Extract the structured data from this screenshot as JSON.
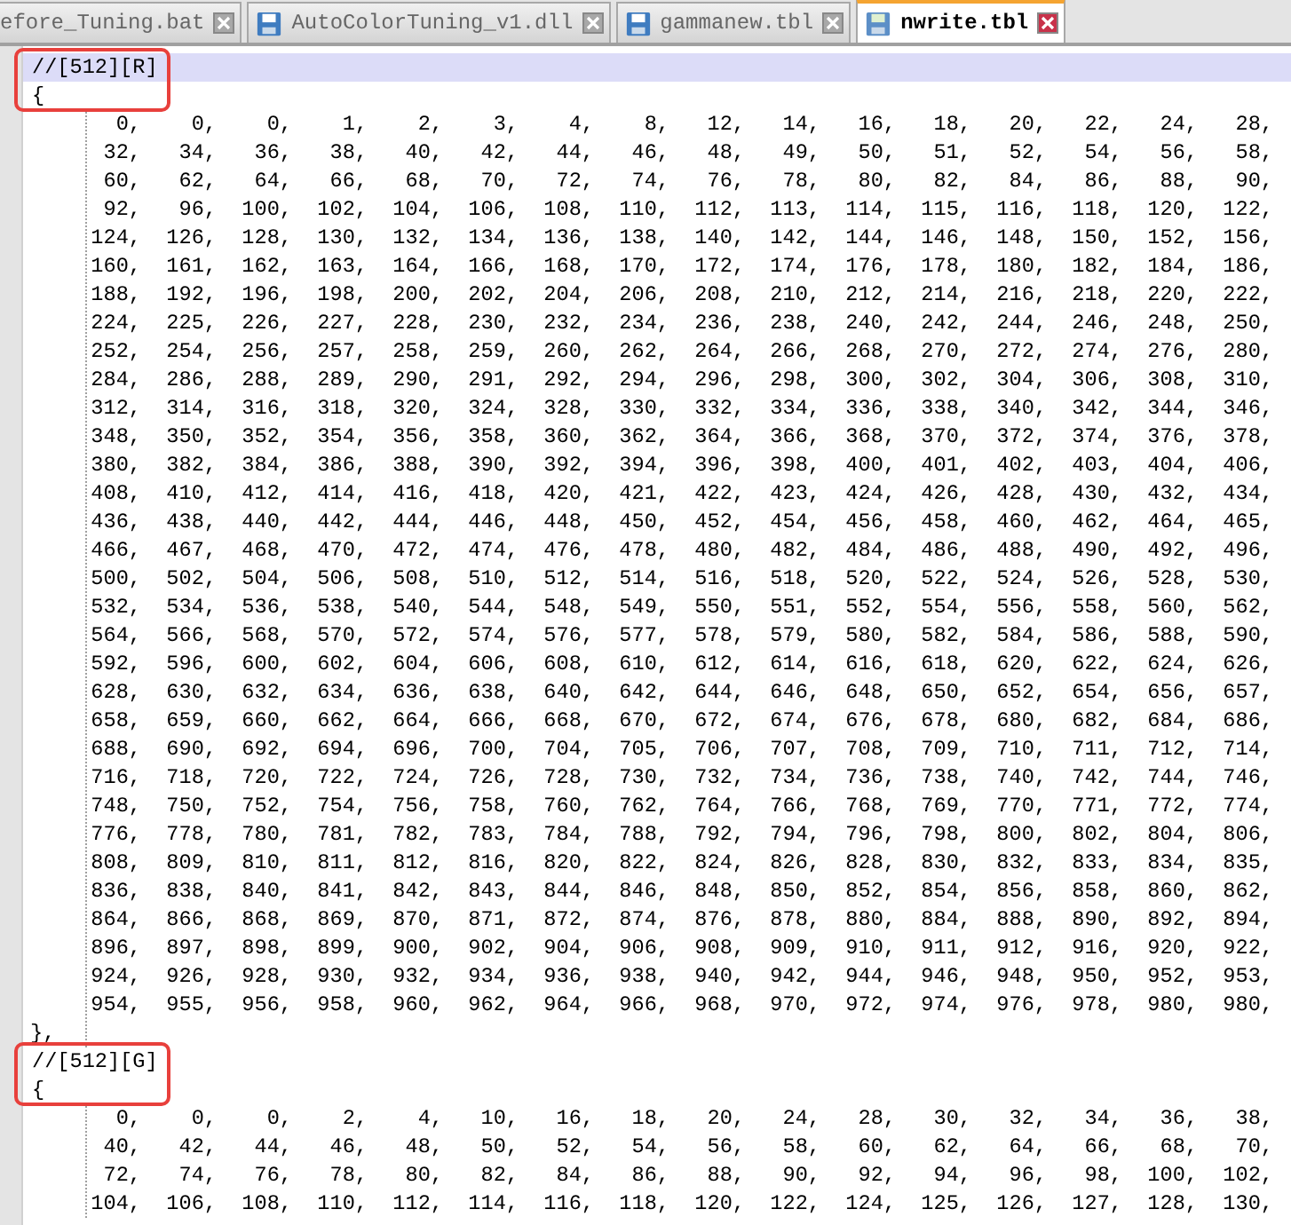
{
  "tabs": [
    {
      "label": "efore_Tuning.bat",
      "selected": false
    },
    {
      "label": "AutoColorTuning_v1.dll",
      "selected": false
    },
    {
      "label": "gammanew.tbl",
      "selected": false
    },
    {
      "label": "nwrite.tbl",
      "selected": true
    }
  ],
  "sections": [
    {
      "header": "//[512][R]",
      "current": true,
      "boxed": true,
      "open": "{",
      "close": "},",
      "rows": [
        [
          "0,",
          "0,",
          "0,",
          "1,",
          "2,",
          "3,",
          "4,",
          "8,",
          "12,",
          "14,",
          "16,",
          "18,",
          "20,",
          "22,",
          "24,",
          "28,"
        ],
        [
          "32,",
          "34,",
          "36,",
          "38,",
          "40,",
          "42,",
          "44,",
          "46,",
          "48,",
          "49,",
          "50,",
          "51,",
          "52,",
          "54,",
          "56,",
          "58,"
        ],
        [
          "60,",
          "62,",
          "64,",
          "66,",
          "68,",
          "70,",
          "72,",
          "74,",
          "76,",
          "78,",
          "80,",
          "82,",
          "84,",
          "86,",
          "88,",
          "90,"
        ],
        [
          "92,",
          "96,",
          "100,",
          "102,",
          "104,",
          "106,",
          "108,",
          "110,",
          "112,",
          "113,",
          "114,",
          "115,",
          "116,",
          "118,",
          "120,",
          "122,"
        ],
        [
          "124,",
          "126,",
          "128,",
          "130,",
          "132,",
          "134,",
          "136,",
          "138,",
          "140,",
          "142,",
          "144,",
          "146,",
          "148,",
          "150,",
          "152,",
          "156,"
        ],
        [
          "160,",
          "161,",
          "162,",
          "163,",
          "164,",
          "166,",
          "168,",
          "170,",
          "172,",
          "174,",
          "176,",
          "178,",
          "180,",
          "182,",
          "184,",
          "186,"
        ],
        [
          "188,",
          "192,",
          "196,",
          "198,",
          "200,",
          "202,",
          "204,",
          "206,",
          "208,",
          "210,",
          "212,",
          "214,",
          "216,",
          "218,",
          "220,",
          "222,"
        ],
        [
          "224,",
          "225,",
          "226,",
          "227,",
          "228,",
          "230,",
          "232,",
          "234,",
          "236,",
          "238,",
          "240,",
          "242,",
          "244,",
          "246,",
          "248,",
          "250,"
        ],
        [
          "252,",
          "254,",
          "256,",
          "257,",
          "258,",
          "259,",
          "260,",
          "262,",
          "264,",
          "266,",
          "268,",
          "270,",
          "272,",
          "274,",
          "276,",
          "280,"
        ],
        [
          "284,",
          "286,",
          "288,",
          "289,",
          "290,",
          "291,",
          "292,",
          "294,",
          "296,",
          "298,",
          "300,",
          "302,",
          "304,",
          "306,",
          "308,",
          "310,"
        ],
        [
          "312,",
          "314,",
          "316,",
          "318,",
          "320,",
          "324,",
          "328,",
          "330,",
          "332,",
          "334,",
          "336,",
          "338,",
          "340,",
          "342,",
          "344,",
          "346,"
        ],
        [
          "348,",
          "350,",
          "352,",
          "354,",
          "356,",
          "358,",
          "360,",
          "362,",
          "364,",
          "366,",
          "368,",
          "370,",
          "372,",
          "374,",
          "376,",
          "378,"
        ],
        [
          "380,",
          "382,",
          "384,",
          "386,",
          "388,",
          "390,",
          "392,",
          "394,",
          "396,",
          "398,",
          "400,",
          "401,",
          "402,",
          "403,",
          "404,",
          "406,"
        ],
        [
          "408,",
          "410,",
          "412,",
          "414,",
          "416,",
          "418,",
          "420,",
          "421,",
          "422,",
          "423,",
          "424,",
          "426,",
          "428,",
          "430,",
          "432,",
          "434,"
        ],
        [
          "436,",
          "438,",
          "440,",
          "442,",
          "444,",
          "446,",
          "448,",
          "450,",
          "452,",
          "454,",
          "456,",
          "458,",
          "460,",
          "462,",
          "464,",
          "465,"
        ],
        [
          "466,",
          "467,",
          "468,",
          "470,",
          "472,",
          "474,",
          "476,",
          "478,",
          "480,",
          "482,",
          "484,",
          "486,",
          "488,",
          "490,",
          "492,",
          "496,"
        ],
        [
          "500,",
          "502,",
          "504,",
          "506,",
          "508,",
          "510,",
          "512,",
          "514,",
          "516,",
          "518,",
          "520,",
          "522,",
          "524,",
          "526,",
          "528,",
          "530,"
        ],
        [
          "532,",
          "534,",
          "536,",
          "538,",
          "540,",
          "544,",
          "548,",
          "549,",
          "550,",
          "551,",
          "552,",
          "554,",
          "556,",
          "558,",
          "560,",
          "562,"
        ],
        [
          "564,",
          "566,",
          "568,",
          "570,",
          "572,",
          "574,",
          "576,",
          "577,",
          "578,",
          "579,",
          "580,",
          "582,",
          "584,",
          "586,",
          "588,",
          "590,"
        ],
        [
          "592,",
          "596,",
          "600,",
          "602,",
          "604,",
          "606,",
          "608,",
          "610,",
          "612,",
          "614,",
          "616,",
          "618,",
          "620,",
          "622,",
          "624,",
          "626,"
        ],
        [
          "628,",
          "630,",
          "632,",
          "634,",
          "636,",
          "638,",
          "640,",
          "642,",
          "644,",
          "646,",
          "648,",
          "650,",
          "652,",
          "654,",
          "656,",
          "657,"
        ],
        [
          "658,",
          "659,",
          "660,",
          "662,",
          "664,",
          "666,",
          "668,",
          "670,",
          "672,",
          "674,",
          "676,",
          "678,",
          "680,",
          "682,",
          "684,",
          "686,"
        ],
        [
          "688,",
          "690,",
          "692,",
          "694,",
          "696,",
          "700,",
          "704,",
          "705,",
          "706,",
          "707,",
          "708,",
          "709,",
          "710,",
          "711,",
          "712,",
          "714,"
        ],
        [
          "716,",
          "718,",
          "720,",
          "722,",
          "724,",
          "726,",
          "728,",
          "730,",
          "732,",
          "734,",
          "736,",
          "738,",
          "740,",
          "742,",
          "744,",
          "746,"
        ],
        [
          "748,",
          "750,",
          "752,",
          "754,",
          "756,",
          "758,",
          "760,",
          "762,",
          "764,",
          "766,",
          "768,",
          "769,",
          "770,",
          "771,",
          "772,",
          "774,"
        ],
        [
          "776,",
          "778,",
          "780,",
          "781,",
          "782,",
          "783,",
          "784,",
          "788,",
          "792,",
          "794,",
          "796,",
          "798,",
          "800,",
          "802,",
          "804,",
          "806,"
        ],
        [
          "808,",
          "809,",
          "810,",
          "811,",
          "812,",
          "816,",
          "820,",
          "822,",
          "824,",
          "826,",
          "828,",
          "830,",
          "832,",
          "833,",
          "834,",
          "835,"
        ],
        [
          "836,",
          "838,",
          "840,",
          "841,",
          "842,",
          "843,",
          "844,",
          "846,",
          "848,",
          "850,",
          "852,",
          "854,",
          "856,",
          "858,",
          "860,",
          "862,"
        ],
        [
          "864,",
          "866,",
          "868,",
          "869,",
          "870,",
          "871,",
          "872,",
          "874,",
          "876,",
          "878,",
          "880,",
          "884,",
          "888,",
          "890,",
          "892,",
          "894,"
        ],
        [
          "896,",
          "897,",
          "898,",
          "899,",
          "900,",
          "902,",
          "904,",
          "906,",
          "908,",
          "909,",
          "910,",
          "911,",
          "912,",
          "916,",
          "920,",
          "922,"
        ],
        [
          "924,",
          "926,",
          "928,",
          "930,",
          "932,",
          "934,",
          "936,",
          "938,",
          "940,",
          "942,",
          "944,",
          "946,",
          "948,",
          "950,",
          "952,",
          "953,"
        ],
        [
          "954,",
          "955,",
          "956,",
          "958,",
          "960,",
          "962,",
          "964,",
          "966,",
          "968,",
          "970,",
          "972,",
          "974,",
          "976,",
          "978,",
          "980,",
          "980,"
        ]
      ]
    },
    {
      "header": "//[512][G]",
      "current": false,
      "boxed": true,
      "open": "{",
      "rows": [
        [
          "0,",
          "0,",
          "0,",
          "2,",
          "4,",
          "10,",
          "16,",
          "18,",
          "20,",
          "24,",
          "28,",
          "30,",
          "32,",
          "34,",
          "36,",
          "38,"
        ],
        [
          "40,",
          "42,",
          "44,",
          "46,",
          "48,",
          "50,",
          "52,",
          "54,",
          "56,",
          "58,",
          "60,",
          "62,",
          "64,",
          "66,",
          "68,",
          "70,"
        ],
        [
          "72,",
          "74,",
          "76,",
          "78,",
          "80,",
          "82,",
          "84,",
          "86,",
          "88,",
          "90,",
          "92,",
          "94,",
          "96,",
          "98,",
          "100,",
          "102,"
        ],
        [
          "104,",
          "106,",
          "108,",
          "110,",
          "112,",
          "114,",
          "116,",
          "118,",
          "120,",
          "122,",
          "124,",
          "125,",
          "126,",
          "127,",
          "128,",
          "130,"
        ]
      ]
    }
  ]
}
